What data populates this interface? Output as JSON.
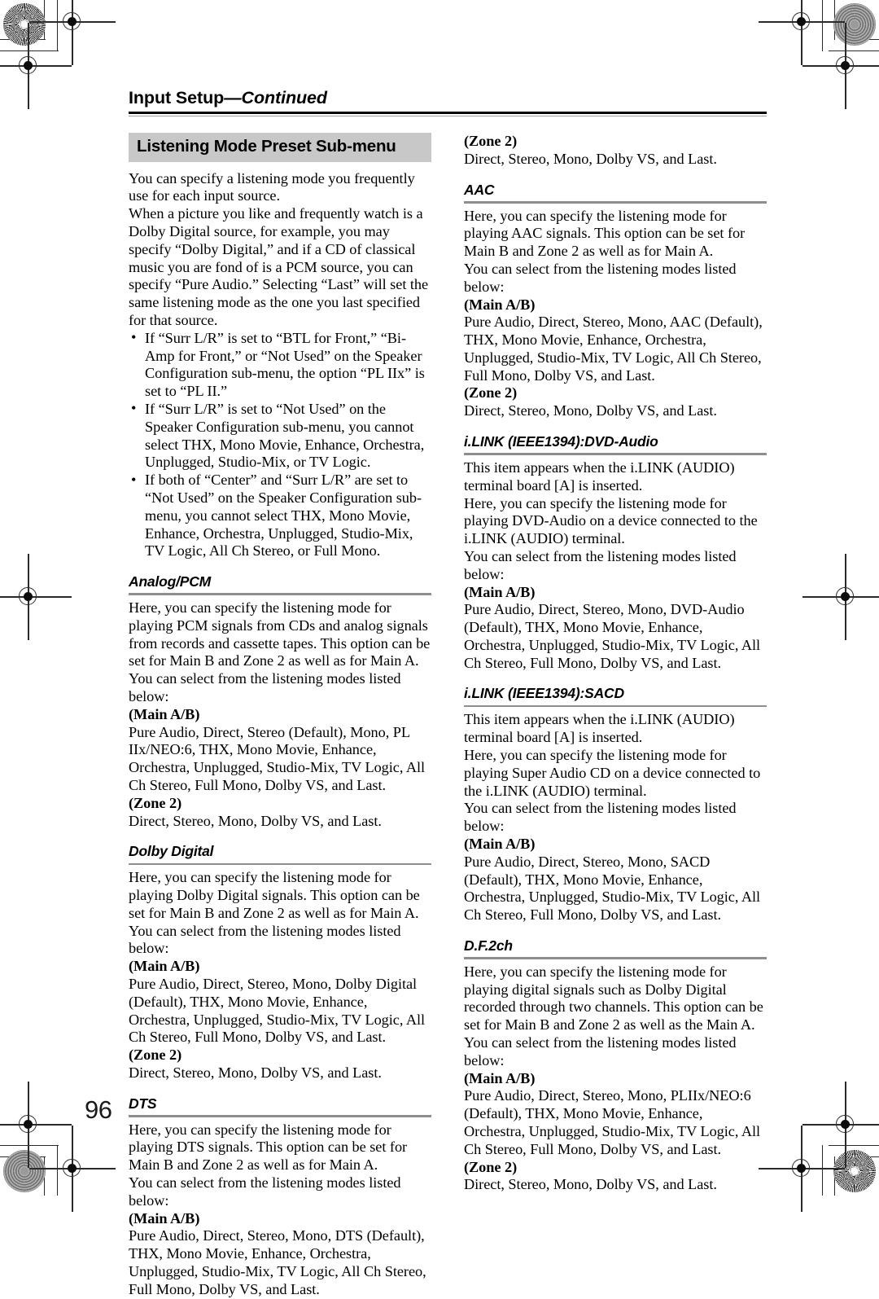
{
  "header": {
    "title_main": "Input Setup",
    "title_cont": "—Continued"
  },
  "banner": {
    "label": "Listening Mode Preset Sub-menu"
  },
  "folio": {
    "page_number": "96"
  },
  "intro": {
    "para1": "You can specify a listening mode you frequently use for each input source.",
    "para2": "When a picture you like and frequently watch is a Dolby Digital source, for example, you may specify “Dolby Digital,” and if a CD of classical music you are fond of is a PCM source, you can specify “Pure Audio.” Selecting “Last” will set the same listening mode as the one you last specified for that source.",
    "bullets": [
      "If “Surr L/R” is set to “BTL for Front,” “Bi-Amp for Front,” or “Not Used” on the Speaker Configuration sub-menu, the option “PL IIx” is set to “PL II.”",
      "If “Surr L/R” is set to “Not Used” on the Speaker Configuration sub-menu, you cannot select THX, Mono Movie, Enhance, Orchestra, Unplugged, Studio-Mix, or TV Logic.",
      "If both of “Center” and “Surr L/R” are set to “Not Used” on the Speaker Configuration sub-menu, you cannot select THX, Mono Movie, Enhance, Orchestra, Unplugged, Studio-Mix, TV Logic, All Ch Stereo, or Full Mono."
    ]
  },
  "labels": {
    "main_ab": "(Main A/B)",
    "zone2": "(Zone 2)",
    "select_line": "You can select from the listening modes listed below:"
  },
  "sections": {
    "analog_pcm": {
      "title": "Analog/PCM",
      "body": "Here, you can specify the listening mode for playing PCM signals from CDs and analog signals from records and cassette tapes. This option can be set for Main B and Zone 2 as well as for Main A.",
      "main_ab_modes": "Pure Audio, Direct, Stereo (Default), Mono, PL IIx/NEO:6, THX, Mono Movie, Enhance, Orchestra, Unplugged, Studio-Mix, TV Logic, All Ch Stereo, Full Mono, Dolby VS, and Last.",
      "zone2_modes": "Direct, Stereo, Mono, Dolby VS, and Last."
    },
    "dolby_digital": {
      "title": "Dolby Digital",
      "body": "Here, you can specify the listening mode for playing Dolby Digital signals. This option can be set for Main B and Zone 2 as well as for Main A.",
      "main_ab_modes": "Pure Audio, Direct, Stereo, Mono, Dolby Digital (Default), THX, Mono Movie, Enhance, Orchestra, Unplugged, Studio-Mix, TV Logic, All Ch Stereo, Full Mono, Dolby VS, and Last.",
      "zone2_modes": "Direct, Stereo, Mono, Dolby VS, and Last."
    },
    "dts": {
      "title": "DTS",
      "body": "Here, you can specify the listening mode for playing DTS signals. This option can be set for Main B and Zone 2 as well as for Main A.",
      "main_ab_modes": "Pure Audio, Direct, Stereo, Mono, DTS (Default), THX, Mono Movie, Enhance, Orchestra, Unplugged, Studio-Mix, TV Logic, All Ch Stereo, Full Mono, Dolby VS, and Last.",
      "zone2_modes": "Direct, Stereo, Mono, Dolby VS, and Last."
    },
    "aac": {
      "title": "AAC",
      "body": "Here, you can specify the listening mode for playing AAC signals. This option can be set for Main B and Zone 2 as well as for Main A.",
      "main_ab_modes": "Pure Audio, Direct, Stereo, Mono, AAC (Default), THX, Mono Movie, Enhance, Orchestra, Unplugged, Studio-Mix, TV Logic, All Ch Stereo, Full Mono, Dolby VS, and Last.",
      "zone2_modes": "Direct, Stereo, Mono, Dolby VS, and Last."
    },
    "ilink_dvd_audio": {
      "title": "i.LINK (IEEE1394):DVD-Audio",
      "body_a": "This item appears when the i.LINK (AUDIO) terminal board [A] is inserted.",
      "body_b": "Here, you can specify the listening mode for playing DVD-Audio on a device connected to the i.LINK (AUDIO) terminal.",
      "main_ab_modes": "Pure Audio, Direct, Stereo, Mono, DVD-Audio (Default), THX, Mono Movie, Enhance, Orchestra, Unplugged, Studio-Mix, TV Logic, All Ch Stereo, Full Mono, Dolby VS, and Last."
    },
    "ilink_sacd": {
      "title": "i.LINK (IEEE1394):SACD",
      "body_a": "This item appears when the i.LINK (AUDIO) terminal board [A] is inserted.",
      "body_b": "Here, you can specify the listening mode for playing Super Audio CD on a device connected to the i.LINK (AUDIO) terminal.",
      "main_ab_modes": "Pure Audio, Direct, Stereo, Mono, SACD (Default), THX, Mono Movie, Enhance, Orchestra, Unplugged, Studio-Mix, TV Logic, All Ch Stereo, Full Mono, Dolby VS, and Last."
    },
    "df2ch": {
      "title": "D.F.2ch",
      "body": "Here, you can specify the listening mode for playing digital signals such as Dolby Digital recorded through two channels. This option can be set for Main B and Zone 2 as well as the Main A.",
      "main_ab_modes": "Pure Audio, Direct, Stereo, Mono, PLIIx/NEO:6 (Default), THX, Mono Movie, Enhance, Orchestra, Unplugged, Studio-Mix, TV Logic, All Ch Stereo, Full Mono, Dolby VS, and Last.",
      "zone2_modes": "Direct, Stereo, Mono, Dolby VS, and Last."
    }
  },
  "colors": {
    "banner_bg": "#c8c8c8",
    "rule_gray": "#8e8e8e",
    "text": "#000000"
  }
}
